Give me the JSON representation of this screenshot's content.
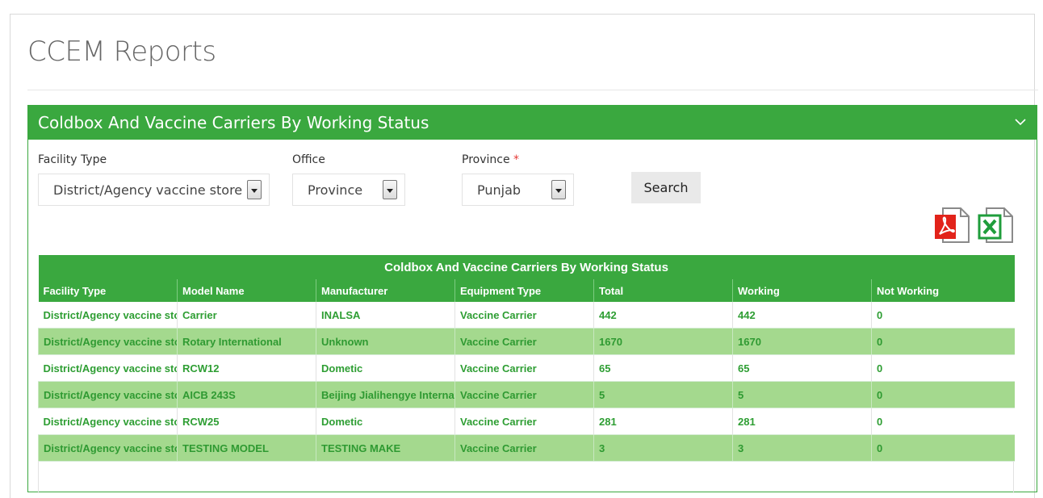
{
  "page": {
    "title": "CCEM Reports"
  },
  "panel": {
    "title": "Coldbox And Vaccine Carriers By Working Status",
    "collapse_icon": "chevron-down-icon"
  },
  "filters": {
    "facility_type": {
      "label": "Facility Type",
      "value": "District/Agency vaccine store"
    },
    "office": {
      "label": "Office",
      "value": "Province"
    },
    "province": {
      "label": "Province",
      "required_mark": "*",
      "value": "Punjab"
    },
    "search_label": "Search"
  },
  "exports": {
    "pdf_icon": "pdf-file-icon",
    "excel_icon": "excel-file-icon",
    "pdf_color": "#e2231a",
    "excel_color": "#1f9d3b"
  },
  "table": {
    "caption": "Coldbox And Vaccine Carriers By Working Status",
    "columns": [
      "Facility Type",
      "Model Name",
      "Manufacturer",
      "Equipment Type",
      "Total",
      "Working",
      "Not Working"
    ],
    "rows": [
      [
        "District/Agency vaccine store",
        "Carrier",
        "INALSA",
        "Vaccine Carrier",
        "442",
        "442",
        "0"
      ],
      [
        "District/Agency vaccine store",
        "Rotary International",
        "Unknown",
        "Vaccine Carrier",
        "1670",
        "1670",
        "0"
      ],
      [
        "District/Agency vaccine store",
        "RCW12",
        "Dometic",
        "Vaccine Carrier",
        "65",
        "65",
        "0"
      ],
      [
        "District/Agency vaccine store",
        "AICB 243S",
        "Beijing Jialihengye International",
        "Vaccine Carrier",
        "5",
        "5",
        "0"
      ],
      [
        "District/Agency vaccine store",
        "RCW25",
        "Dometic",
        "Vaccine Carrier",
        "281",
        "281",
        "0"
      ],
      [
        "District/Agency vaccine store",
        "TESTING MODEL",
        "TESTING MAKE",
        "Vaccine Carrier",
        "3",
        "3",
        "0"
      ]
    ]
  },
  "colors": {
    "accent": "#3aa83f",
    "row_alt": "#a4d98e",
    "cell_text": "#2e9e33"
  }
}
